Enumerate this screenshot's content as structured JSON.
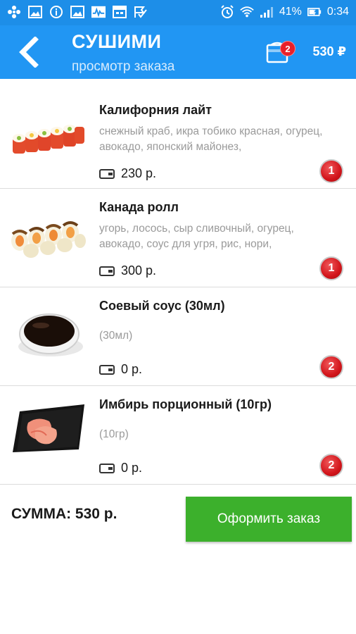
{
  "status_bar": {
    "battery": "41%",
    "time": "0:34",
    "left_icons": [
      "pinwheel-icon",
      "image-icon",
      "info-icon",
      "image-icon",
      "activity-icon",
      "calendar-icon",
      "check-flag-icon"
    ],
    "right_icons": [
      "alarm-icon",
      "wifi-icon",
      "signal-icon",
      "battery-icon"
    ]
  },
  "header": {
    "title": "СУШИМИ",
    "subtitle": "просмотр заказа",
    "cart_count": "2",
    "cart_total": "530 ₽",
    "colors": {
      "bar": "#2196f3",
      "status": "#1d8ee8"
    }
  },
  "items": [
    {
      "name": "Калифорния лайт",
      "description": "снежный краб, икра тобико красная, огурец, авокадо, японский майонез,",
      "price": "230 р.",
      "quantity": "1",
      "image": "california-roll-image"
    },
    {
      "name": "Канада ролл",
      "description": "угорь, лосось, сыр сливочный, огурец, авокадо, соус для угря, рис, нори,",
      "price": "300 р.",
      "quantity": "1",
      "image": "canada-roll-image"
    },
    {
      "name": "Соевый соус (30мл)",
      "description": "(30мл)",
      "price": "0 р.",
      "quantity": "2",
      "image": "soy-sauce-image"
    },
    {
      "name": "Имбирь порционный (10гр)",
      "description": "(10гр)",
      "price": "0 р.",
      "quantity": "2",
      "image": "ginger-image"
    }
  ],
  "footer": {
    "sum_label": "СУММА: 530 р.",
    "order_button": "Оформить заказ",
    "button_color": "#3cb02c"
  }
}
